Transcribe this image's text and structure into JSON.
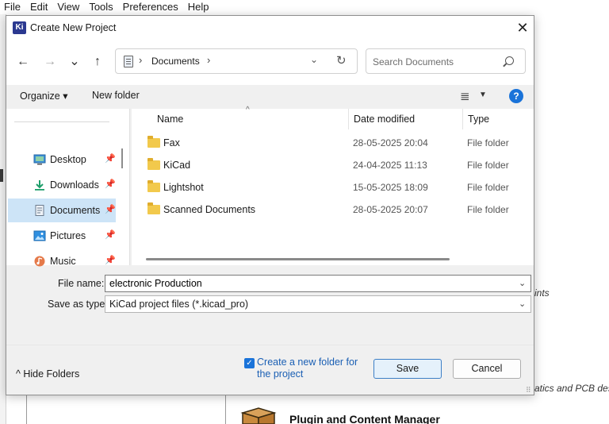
{
  "menubar": [
    "File",
    "Edit",
    "View",
    "Tools",
    "Preferences",
    "Help"
  ],
  "background": {
    "text_ints": "ints",
    "text_atics": "atics and PCB des",
    "plugin_title": "Plugin and Content Manager"
  },
  "dialog": {
    "app_icon_text": "Ki",
    "title": "Create New Project",
    "close_glyph": "✕"
  },
  "nav": {
    "back_glyph": "←",
    "forward_glyph": "→",
    "recent_glyph": "⌄",
    "up_glyph": "↑",
    "address_sep": "›",
    "address_folder": "Documents",
    "address_drop": "⌄",
    "refresh_glyph": "↻",
    "search_placeholder": "Search Documents"
  },
  "toolbar": {
    "organize": "Organize ▾",
    "new_folder": "New folder",
    "view_glyph": "≣",
    "view_drop": "▼",
    "help_glyph": "?"
  },
  "navpane": {
    "items": [
      {
        "label": "Desktop",
        "icon": "desktop-icon",
        "pinned": true,
        "selected": false
      },
      {
        "label": "Downloads",
        "icon": "download-icon",
        "pinned": true,
        "selected": false
      },
      {
        "label": "Documents",
        "icon": "documents-icon",
        "pinned": true,
        "selected": true
      },
      {
        "label": "Pictures",
        "icon": "pictures-icon",
        "pinned": true,
        "selected": false
      },
      {
        "label": "Music",
        "icon": "music-icon",
        "pinned": true,
        "selected": false
      }
    ],
    "pin_glyph": "📌"
  },
  "filelist": {
    "columns": [
      "Name",
      "Date modified",
      "Type"
    ],
    "sort_glyph": "^",
    "rows": [
      {
        "name": "Fax",
        "date": "28-05-2025 20:04",
        "type": "File folder"
      },
      {
        "name": "KiCad",
        "date": "24-04-2025 11:13",
        "type": "File folder"
      },
      {
        "name": "Lightshot",
        "date": "15-05-2025 18:09",
        "type": "File folder"
      },
      {
        "name": "Scanned Documents",
        "date": "28-05-2025 20:07",
        "type": "File folder"
      }
    ]
  },
  "form": {
    "file_name_label": "File name:",
    "file_name_value": "electronic Production",
    "save_type_label": "Save as type:",
    "save_type_value": "KiCad project files (*.kicad_pro)",
    "drop_glyph": "⌄"
  },
  "footer": {
    "hide_folders": "^  Hide Folders",
    "checkbox_checked": true,
    "checkbox_glyph": "✓",
    "checkbox_label": "Create a new folder for the project",
    "save": "Save",
    "cancel": "Cancel",
    "grip": "⠿"
  },
  "colors": {
    "accent": "#1a73d9",
    "selection": "#cde4f7",
    "folder": "#f2c94c",
    "kicad_badge": "#2b3990"
  }
}
